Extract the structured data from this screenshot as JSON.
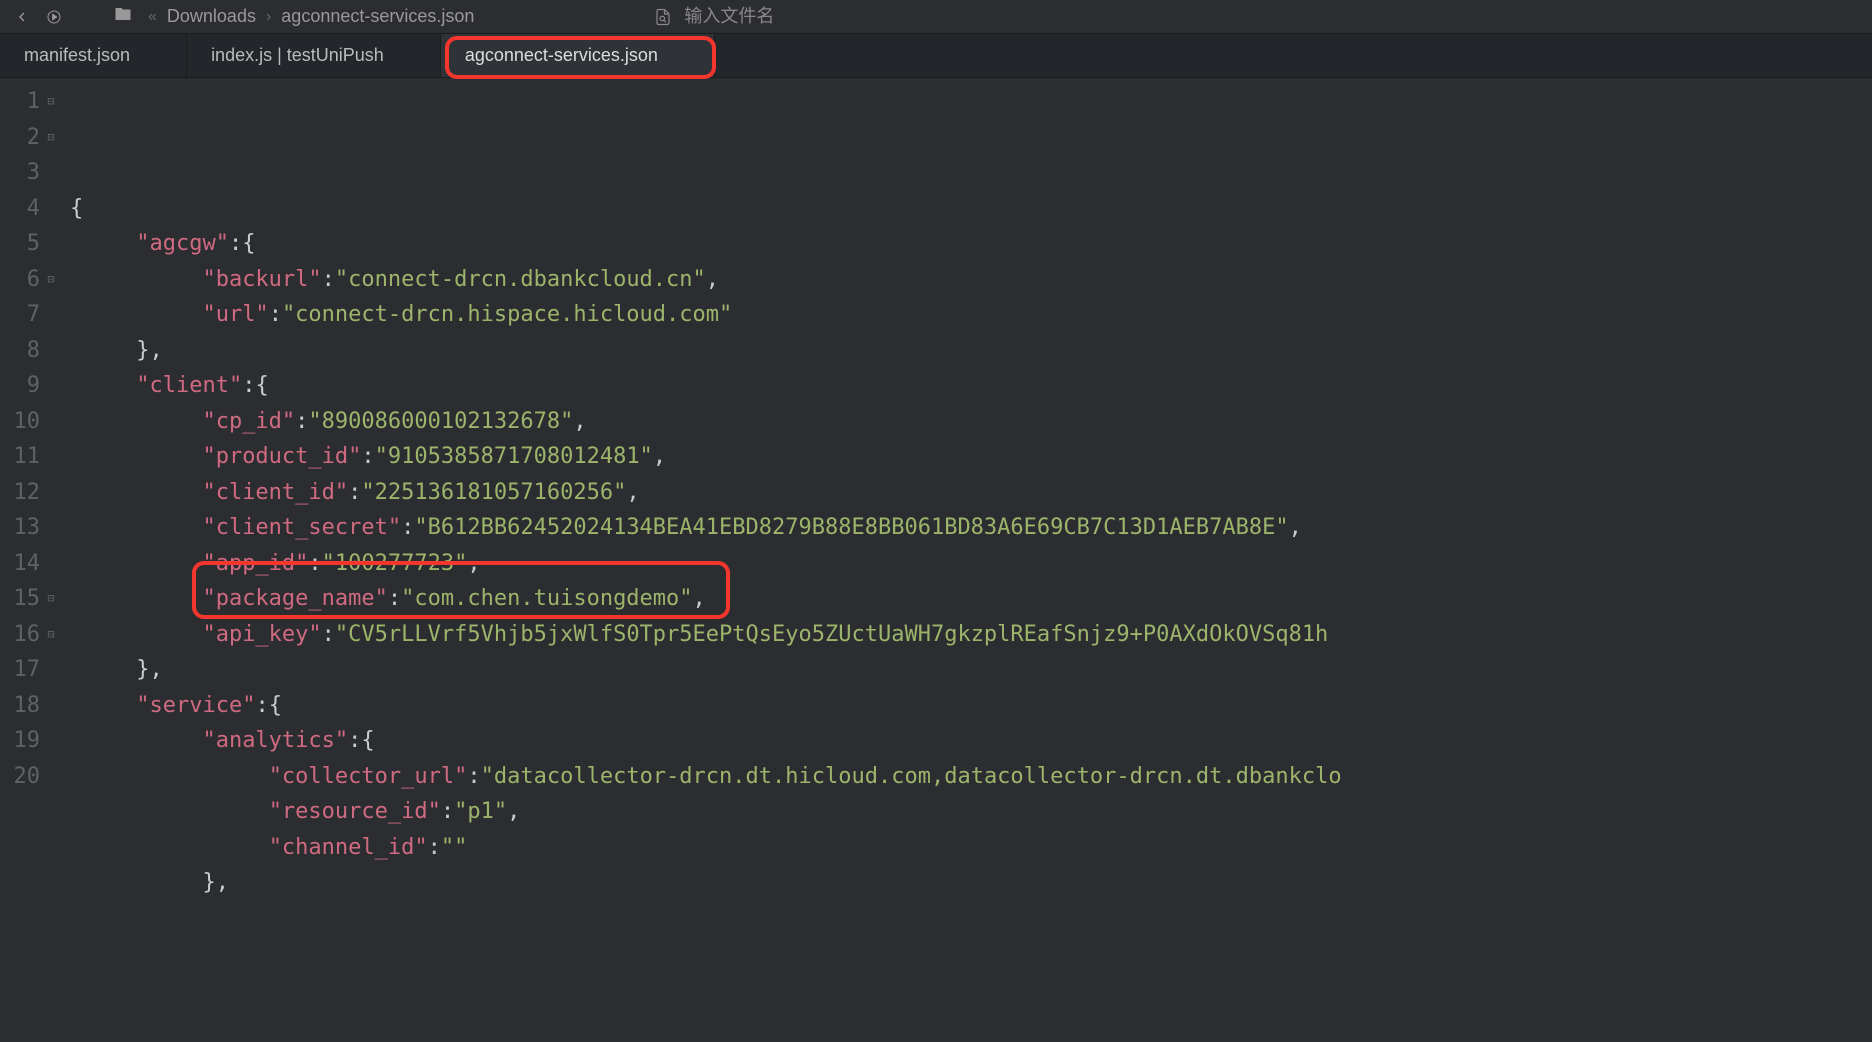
{
  "toolbar": {
    "breadcrumb": [
      "Downloads",
      "agconnect-services.json"
    ],
    "search_placeholder": "输入文件名"
  },
  "tabs": [
    {
      "label": "manifest.json",
      "active": false
    },
    {
      "label": "index.js | testUniPush",
      "active": false
    },
    {
      "label": "agconnect-services.json",
      "active": true,
      "highlighted": true
    }
  ],
  "code_lines": [
    {
      "n": 1,
      "fold": "⊟",
      "indent": 0,
      "tokens": [
        {
          "t": "p",
          "v": "{"
        }
      ]
    },
    {
      "n": 2,
      "fold": "⊟",
      "indent": 1,
      "tokens": [
        {
          "t": "k",
          "v": "\"agcgw\""
        },
        {
          "t": "p",
          "v": ":{"
        }
      ]
    },
    {
      "n": 3,
      "fold": "",
      "indent": 2,
      "tokens": [
        {
          "t": "k",
          "v": "\"backurl\""
        },
        {
          "t": "p",
          "v": ":"
        },
        {
          "t": "s",
          "v": "\"connect-drcn.dbankcloud.cn\""
        },
        {
          "t": "p",
          "v": ","
        }
      ]
    },
    {
      "n": 4,
      "fold": "",
      "indent": 2,
      "tokens": [
        {
          "t": "k",
          "v": "\"url\""
        },
        {
          "t": "p",
          "v": ":"
        },
        {
          "t": "s",
          "v": "\"connect-drcn.hispace.hicloud.com\""
        }
      ]
    },
    {
      "n": 5,
      "fold": "",
      "indent": 1,
      "tokens": [
        {
          "t": "p",
          "v": "},"
        }
      ]
    },
    {
      "n": 6,
      "fold": "⊟",
      "indent": 1,
      "tokens": [
        {
          "t": "k",
          "v": "\"client\""
        },
        {
          "t": "p",
          "v": ":{"
        }
      ]
    },
    {
      "n": 7,
      "fold": "",
      "indent": 2,
      "tokens": [
        {
          "t": "k",
          "v": "\"cp_id\""
        },
        {
          "t": "p",
          "v": ":"
        },
        {
          "t": "s",
          "v": "\"890086000102132678\""
        },
        {
          "t": "p",
          "v": ","
        }
      ]
    },
    {
      "n": 8,
      "fold": "",
      "indent": 2,
      "tokens": [
        {
          "t": "k",
          "v": "\"product_id\""
        },
        {
          "t": "p",
          "v": ":"
        },
        {
          "t": "s",
          "v": "\"9105385871708012481\""
        },
        {
          "t": "p",
          "v": ","
        }
      ]
    },
    {
      "n": 9,
      "fold": "",
      "indent": 2,
      "tokens": [
        {
          "t": "k",
          "v": "\"client_id\""
        },
        {
          "t": "p",
          "v": ":"
        },
        {
          "t": "s",
          "v": "\"225136181057160256\""
        },
        {
          "t": "p",
          "v": ","
        }
      ]
    },
    {
      "n": 10,
      "fold": "",
      "indent": 2,
      "tokens": [
        {
          "t": "k",
          "v": "\"client_secret\""
        },
        {
          "t": "p",
          "v": ":"
        },
        {
          "t": "s",
          "v": "\"B612BB62452024134BEA41EBD8279B88E8BB061BD83A6E69CB7C13D1AEB7AB8E\""
        },
        {
          "t": "p",
          "v": ","
        }
      ]
    },
    {
      "n": 11,
      "fold": "",
      "indent": 2,
      "tokens": [
        {
          "t": "k",
          "v": "\"app_id\""
        },
        {
          "t": "p",
          "v": ":"
        },
        {
          "t": "s",
          "v": "\"100277723\""
        },
        {
          "t": "p",
          "v": ","
        }
      ]
    },
    {
      "n": 12,
      "fold": "",
      "indent": 2,
      "tokens": [
        {
          "t": "k",
          "v": "\"package_name\""
        },
        {
          "t": "p",
          "v": ":"
        },
        {
          "t": "s",
          "v": "\"com.chen.tuisongdemo\""
        },
        {
          "t": "p",
          "v": ","
        }
      ]
    },
    {
      "n": 13,
      "fold": "",
      "indent": 2,
      "tokens": [
        {
          "t": "k",
          "v": "\"api_key\""
        },
        {
          "t": "p",
          "v": ":"
        },
        {
          "t": "s",
          "v": "\"CV5rLLVrf5Vhjb5jxWlfS0Tpr5EePtQsEyo5ZUctUaWH7gkzplREafSnjz9+P0AXdOkOVSq81h"
        }
      ]
    },
    {
      "n": 14,
      "fold": "",
      "indent": 1,
      "tokens": [
        {
          "t": "p",
          "v": "},"
        }
      ]
    },
    {
      "n": 15,
      "fold": "⊟",
      "indent": 1,
      "tokens": [
        {
          "t": "k",
          "v": "\"service\""
        },
        {
          "t": "p",
          "v": ":{"
        }
      ]
    },
    {
      "n": 16,
      "fold": "⊟",
      "indent": 2,
      "tokens": [
        {
          "t": "k",
          "v": "\"analytics\""
        },
        {
          "t": "p",
          "v": ":{"
        }
      ]
    },
    {
      "n": 17,
      "fold": "",
      "indent": 3,
      "tokens": [
        {
          "t": "k",
          "v": "\"collector_url\""
        },
        {
          "t": "p",
          "v": ":"
        },
        {
          "t": "s",
          "v": "\"datacollector-drcn.dt.hicloud.com,datacollector-drcn.dt.dbankclo"
        }
      ]
    },
    {
      "n": 18,
      "fold": "",
      "indent": 3,
      "tokens": [
        {
          "t": "k",
          "v": "\"resource_id\""
        },
        {
          "t": "p",
          "v": ":"
        },
        {
          "t": "s",
          "v": "\"p1\""
        },
        {
          "t": "p",
          "v": ","
        }
      ]
    },
    {
      "n": 19,
      "fold": "",
      "indent": 3,
      "tokens": [
        {
          "t": "k",
          "v": "\"channel_id\""
        },
        {
          "t": "p",
          "v": ":"
        },
        {
          "t": "s",
          "v": "\"\""
        }
      ]
    },
    {
      "n": 20,
      "fold": "",
      "indent": 2,
      "tokens": [
        {
          "t": "p",
          "v": "},"
        }
      ]
    }
  ],
  "highlight_line": 12
}
